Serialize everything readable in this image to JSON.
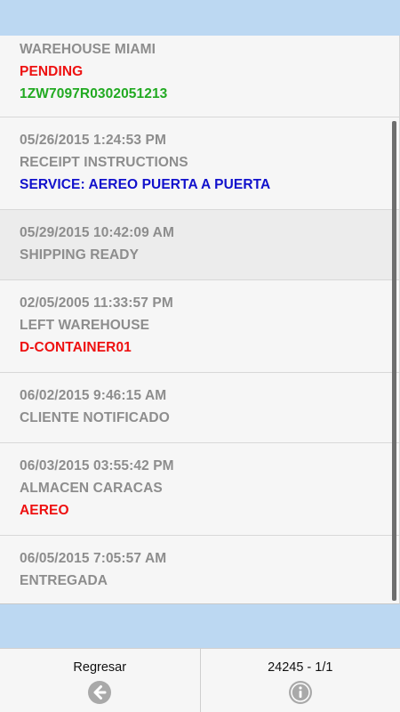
{
  "entries": [
    {
      "lines": [
        {
          "text": "WAREHOUSE MIAMI",
          "color": "gray"
        },
        {
          "text": "PENDING",
          "color": "red"
        },
        {
          "text": "1ZW7097R0302051213",
          "color": "green"
        }
      ]
    },
    {
      "lines": [
        {
          "text": "05/26/2015 1:24:53 PM",
          "color": "gray"
        },
        {
          "text": "RECEIPT INSTRUCTIONS",
          "color": "gray"
        },
        {
          "text": "SERVICE: AEREO PUERTA A PUERTA",
          "color": "blue"
        }
      ]
    },
    {
      "lines": [
        {
          "text": "05/29/2015 10:42:09 AM",
          "color": "gray"
        },
        {
          "text": "SHIPPING READY",
          "color": "gray"
        }
      ]
    },
    {
      "lines": [
        {
          "text": "02/05/2005 11:33:57 PM",
          "color": "gray"
        },
        {
          "text": "LEFT WAREHOUSE",
          "color": "gray"
        },
        {
          "text": "D-CONTAINER01",
          "color": "red"
        }
      ]
    },
    {
      "lines": [
        {
          "text": "06/02/2015 9:46:15 AM",
          "color": "gray"
        },
        {
          "text": "CLIENTE NOTIFICADO",
          "color": "gray"
        }
      ]
    },
    {
      "lines": [
        {
          "text": "06/03/2015 03:55:42 PM",
          "color": "gray"
        },
        {
          "text": "ALMACEN CARACAS",
          "color": "gray"
        },
        {
          "text": "AEREO",
          "color": "red"
        }
      ]
    },
    {
      "lines": [
        {
          "text": "06/05/2015 7:05:57 AM",
          "color": "gray"
        },
        {
          "text": "ENTREGADA",
          "color": "gray"
        }
      ]
    }
  ],
  "footer": {
    "back_label": "Regresar",
    "back_icon": "arrow-left-circle-icon",
    "page_label": "24245 - 1/1",
    "info_icon": "info-circle-icon"
  },
  "colors": {
    "gray": "#8d8d8d",
    "red": "#ee1111",
    "green": "#22aa22",
    "blue": "#1111cc",
    "background": "#bcd8f2"
  }
}
